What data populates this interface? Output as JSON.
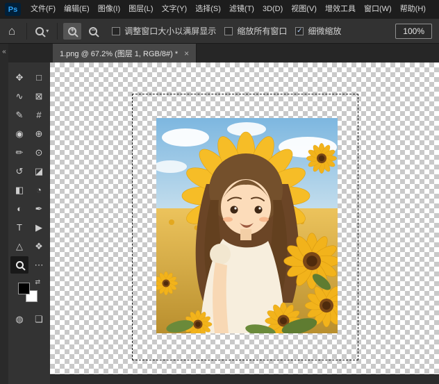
{
  "colors": {
    "ps_logo_blue": "#2fa3f7",
    "panel_dark": "#323232",
    "menu_dark": "#1d1d1d",
    "check_blue": "#a9c9f5",
    "canvas_check_gray": "#c9c9c9"
  },
  "menu_bar": {
    "logo": "Ps",
    "items": [
      "文件(F)",
      "编辑(E)",
      "图像(I)",
      "图层(L)",
      "文字(Y)",
      "选择(S)",
      "滤镜(T)",
      "3D(D)",
      "视图(V)",
      "增效工具",
      "窗口(W)",
      "帮助(H)"
    ]
  },
  "options_bar": {
    "home_glyph": "⌂",
    "tool_caret": "▾",
    "zoom_in_sign": "+",
    "zoom_out_sign": "−",
    "checkboxes": [
      {
        "label": "调整窗口大小以满屏显示",
        "mark": ""
      },
      {
        "label": "缩放所有窗口",
        "mark": ""
      },
      {
        "label": "细微缩放",
        "mark": "✓"
      }
    ],
    "zoom_level": "100%"
  },
  "tab_bar": {
    "collapse_glyph": "«",
    "tabs": [
      {
        "title": "1.png @ 67.2% (图层 1, RGB/8#) *",
        "close": "×"
      }
    ]
  },
  "toolbar": {
    "swap_glyph": "⇄",
    "tools": [
      {
        "name": "move-tool",
        "glyph": "✥"
      },
      {
        "name": "rectangular-marquee-tool",
        "glyph": "□"
      },
      {
        "name": "lasso-tool",
        "glyph": "∿"
      },
      {
        "name": "object-selection-tool",
        "glyph": "⊠"
      },
      {
        "name": "quick-selection-tool",
        "glyph": "✎"
      },
      {
        "name": "crop-tool",
        "glyph": "#"
      },
      {
        "name": "eyedropper-tool",
        "glyph": "◉"
      },
      {
        "name": "spot-healing-brush-tool",
        "glyph": "⊕"
      },
      {
        "name": "brush-tool",
        "glyph": "✏"
      },
      {
        "name": "clone-stamp-tool",
        "glyph": "⊙"
      },
      {
        "name": "history-brush-tool",
        "glyph": "↺"
      },
      {
        "name": "eraser-tool",
        "glyph": "◪"
      },
      {
        "name": "gradient-tool",
        "glyph": "◧"
      },
      {
        "name": "blur-tool",
        "glyph": "◔"
      },
      {
        "name": "dodge-tool",
        "glyph": "◐"
      },
      {
        "name": "pen-tool",
        "glyph": "✒"
      },
      {
        "name": "type-tool",
        "glyph": "T"
      },
      {
        "name": "path-selection-tool",
        "glyph": "▶"
      },
      {
        "name": "shape-tool",
        "glyph": "△"
      },
      {
        "name": "hand-tool",
        "glyph": "❖"
      },
      {
        "name": "zoom-tool",
        "glyph": ""
      },
      {
        "name": "edit-toolbar",
        "glyph": "⋯"
      }
    ],
    "bottom": [
      {
        "name": "quick-mask-button",
        "glyph": "◍"
      },
      {
        "name": "screen-mode-button",
        "glyph": "❏"
      }
    ]
  }
}
